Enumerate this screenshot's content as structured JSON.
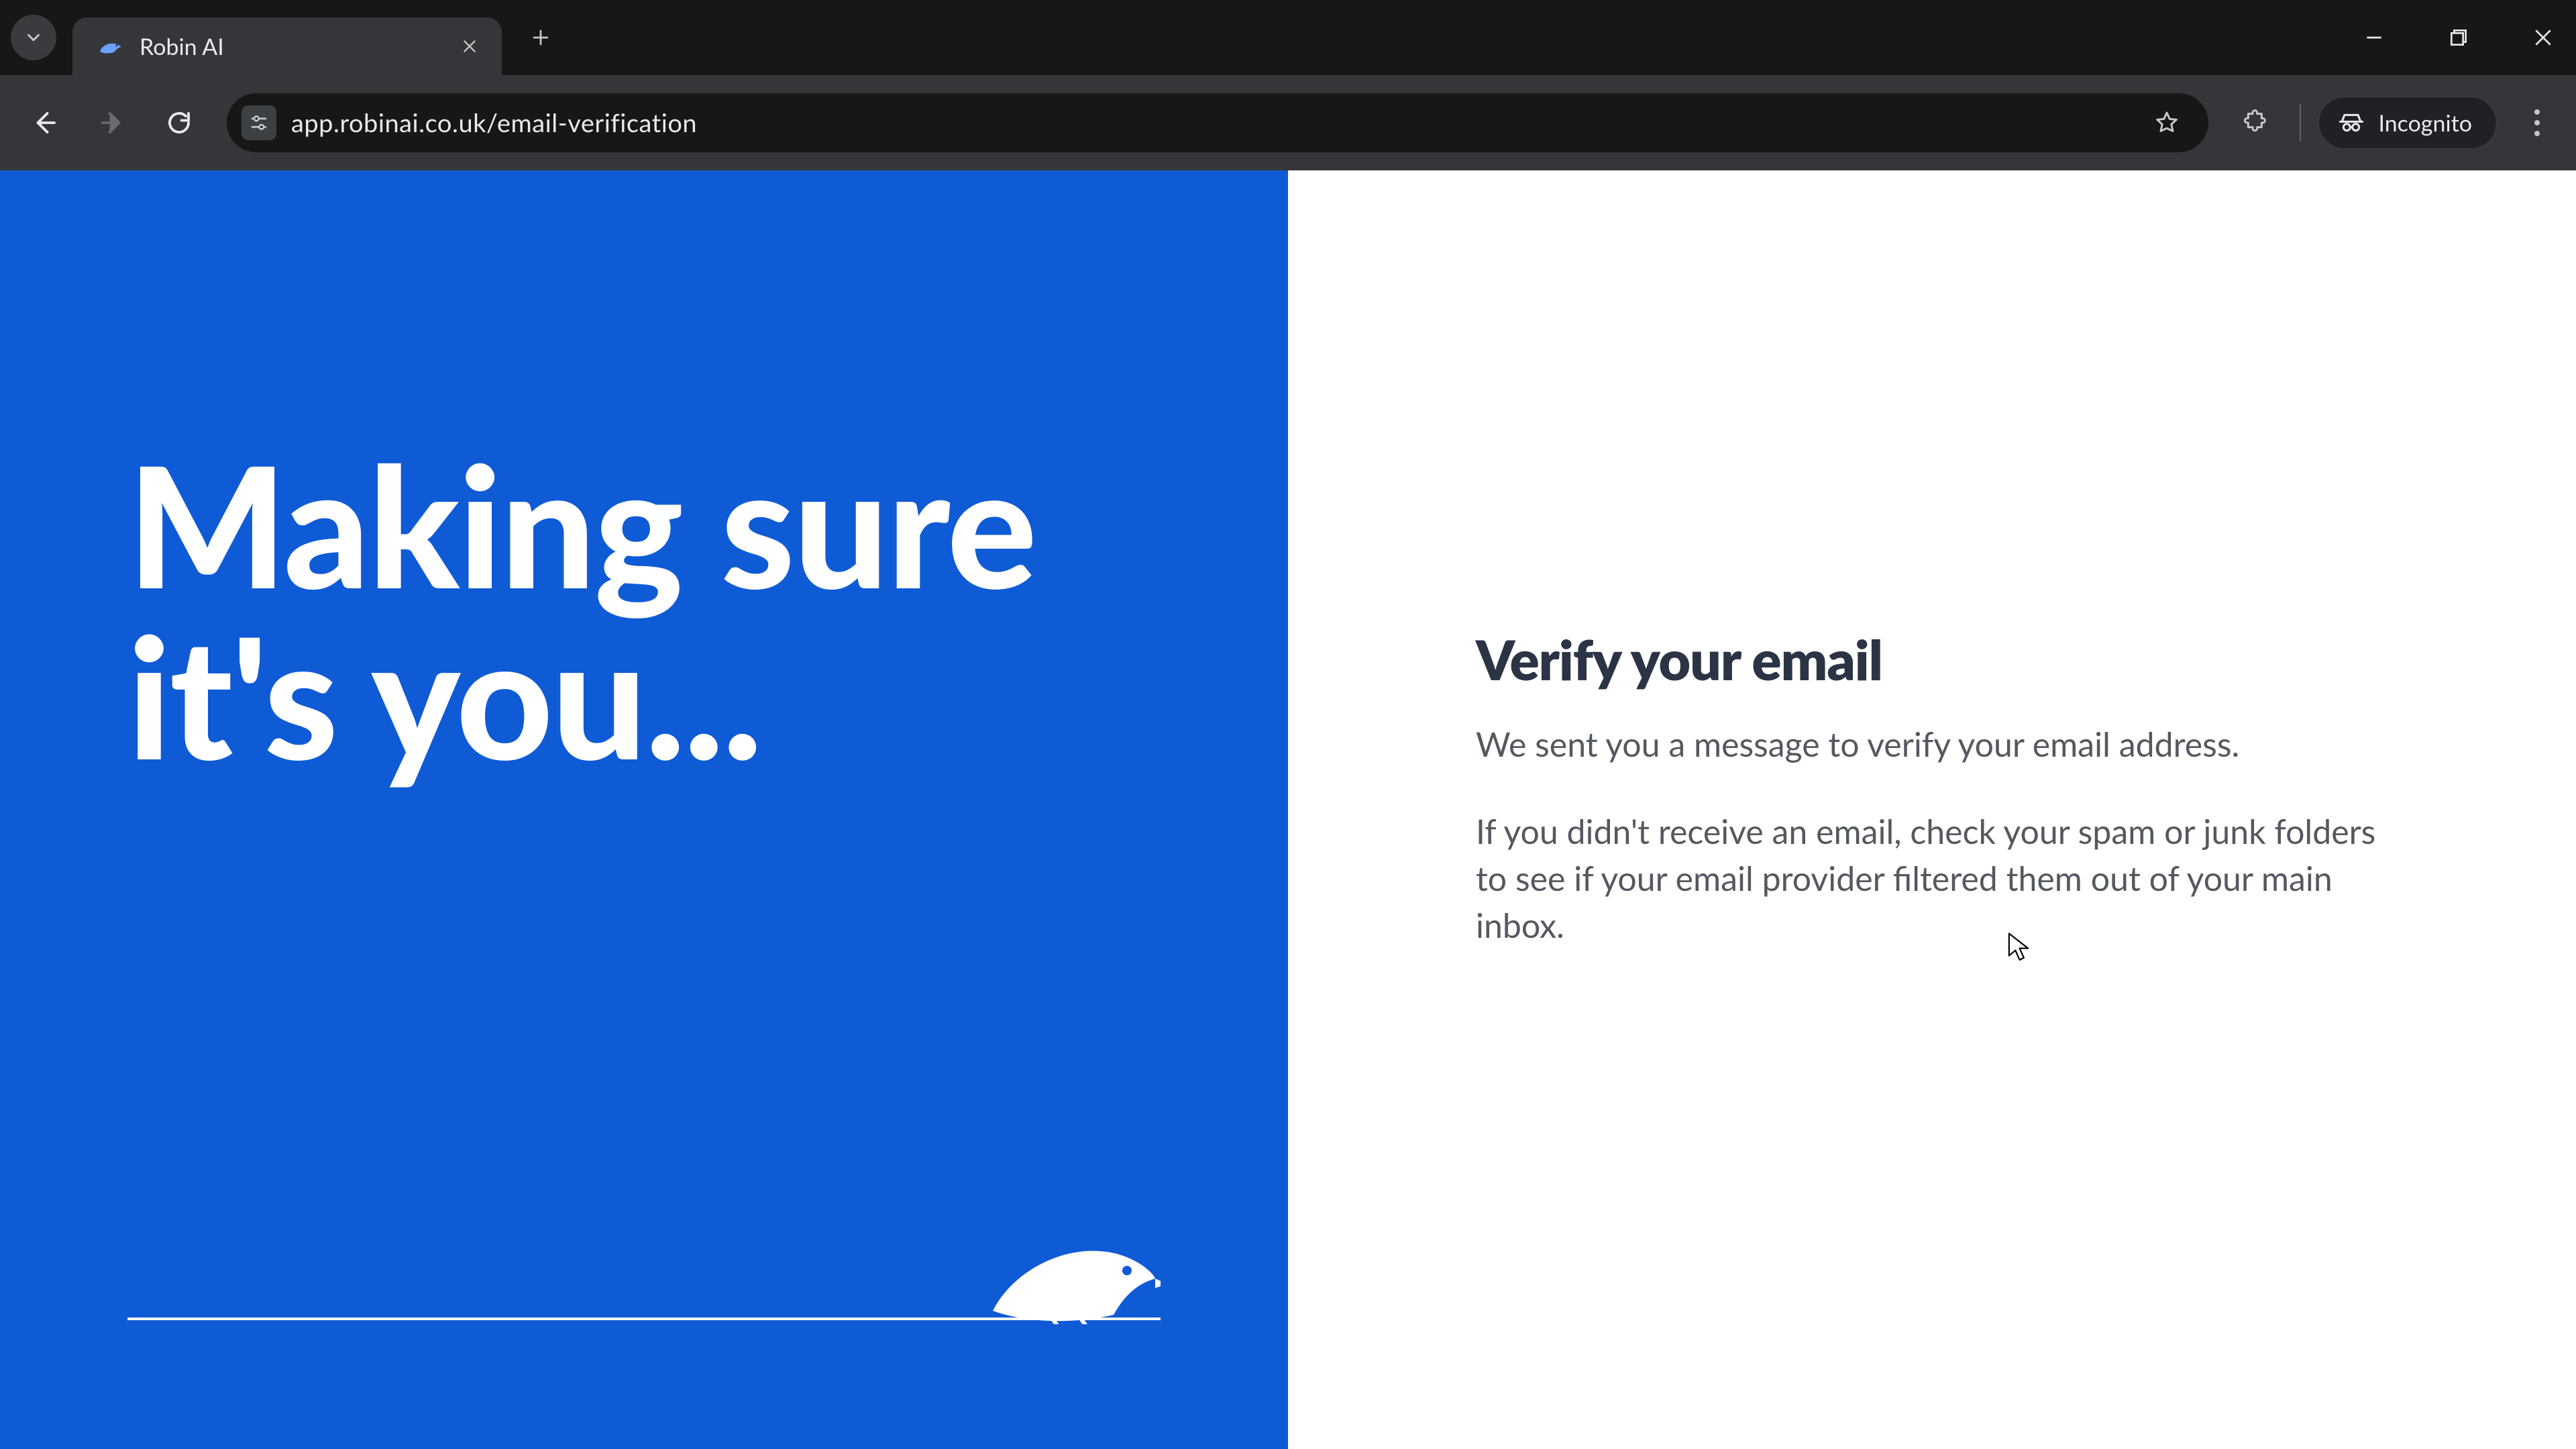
{
  "browser": {
    "tab_title": "Robin AI",
    "url": "app.robinai.co.uk/email-verification",
    "incognito_label": "Incognito"
  },
  "page": {
    "hero": "Making sure it's you...",
    "title": "Verify your email",
    "line1": "We sent you a message to verify your email address.",
    "line2": "If you didn't receive an email, check your spam or junk folders to see if your email provider filtered them out of your main inbox."
  }
}
